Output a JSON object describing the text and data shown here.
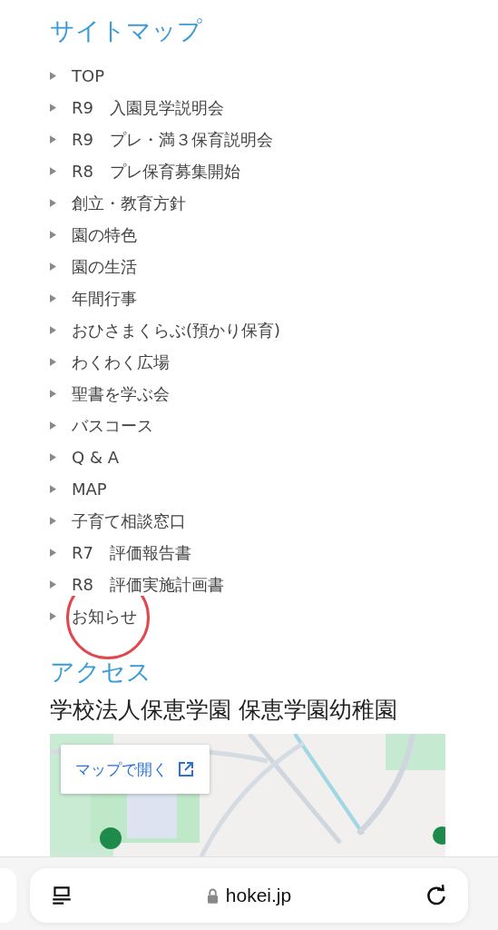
{
  "sitemap": {
    "title": "サイトマップ",
    "items": [
      {
        "label": "TOP",
        "circled": false
      },
      {
        "label": "R9　入園見学説明会",
        "circled": false
      },
      {
        "label": "R9　プレ・満３保育説明会",
        "circled": false
      },
      {
        "label": "R8　プレ保育募集開始",
        "circled": false
      },
      {
        "label": "創立・教育方針",
        "circled": false
      },
      {
        "label": "園の特色",
        "circled": false
      },
      {
        "label": "園の生活",
        "circled": false
      },
      {
        "label": "年間行事",
        "circled": false
      },
      {
        "label": "おひさまくらぶ(預かり保育)",
        "circled": false
      },
      {
        "label": "わくわく広場",
        "circled": false
      },
      {
        "label": "聖書を学ぶ会",
        "circled": false
      },
      {
        "label": "バスコース",
        "circled": false
      },
      {
        "label": "Q & A",
        "circled": false
      },
      {
        "label": "MAP",
        "circled": false
      },
      {
        "label": "子育て相談窓口",
        "circled": false
      },
      {
        "label": "R7　評価報告書",
        "circled": false
      },
      {
        "label": "R8　評価実施計画書",
        "circled": false
      },
      {
        "label": "お知らせ",
        "circled": true
      }
    ]
  },
  "access": {
    "title": "アクセス",
    "name": "学校法人保恵学園 保恵学園幼稚園",
    "map": {
      "kind": "picture",
      "open_button": "マップで開く"
    }
  },
  "browser": {
    "url": "hokei.jp"
  }
}
